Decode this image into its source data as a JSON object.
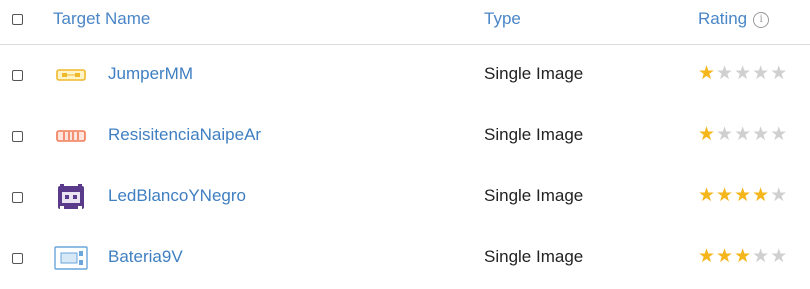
{
  "header": {
    "target_name": "Target Name",
    "type": "Type",
    "rating": "Rating"
  },
  "colors": {
    "star_filled": "#f4b61a",
    "star_empty": "#d0d0d0",
    "link": "#3f7fc1"
  },
  "max_rating": 5,
  "rows": [
    {
      "name": "JumperMM",
      "type": "Single Image",
      "rating": 1,
      "thumb_icon": "jumper-thumbnail-icon"
    },
    {
      "name": "ResisitenciaNaipeAr",
      "type": "Single Image",
      "rating": 1,
      "thumb_icon": "resistor-thumbnail-icon"
    },
    {
      "name": "LedBlancoYNegro",
      "type": "Single Image",
      "rating": 4,
      "thumb_icon": "led-thumbnail-icon"
    },
    {
      "name": "Bateria9V",
      "type": "Single Image",
      "rating": 3,
      "thumb_icon": "battery-thumbnail-icon"
    }
  ]
}
